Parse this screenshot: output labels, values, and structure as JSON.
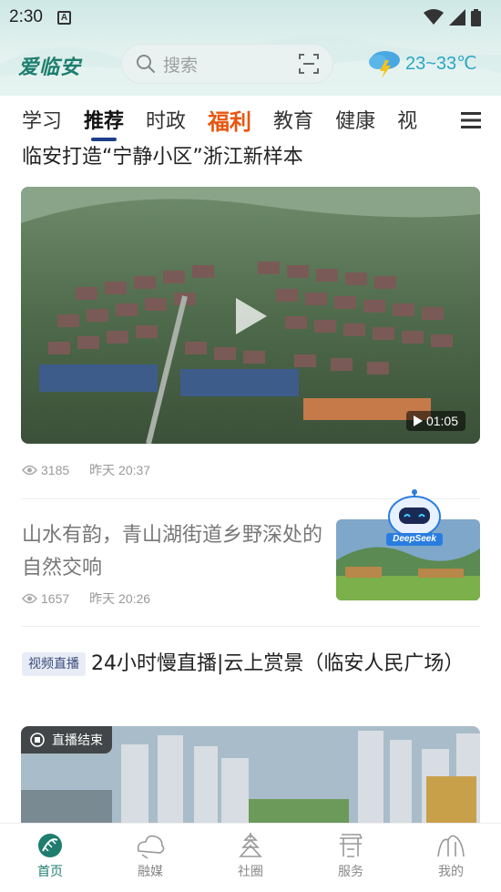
{
  "status_bar": {
    "time": "2:30",
    "notification_letter": "A"
  },
  "header": {
    "logo_text": "爱临安",
    "search_placeholder": "搜索",
    "weather_temp": "23~33℃"
  },
  "tabs": [
    {
      "label": "学习"
    },
    {
      "label": "推荐"
    },
    {
      "label": "时政"
    },
    {
      "label": "福利"
    },
    {
      "label": "教育"
    },
    {
      "label": "健康"
    },
    {
      "label": "视"
    }
  ],
  "feed": {
    "article1": {
      "title": "临安打造“宁静小区”浙江新样本",
      "duration": "01:05",
      "views": "3185",
      "time": "昨天 20:37"
    },
    "article2": {
      "title": "山水有韵，青山湖街道乡野深处的自然交响",
      "views": "1657",
      "time": "昨天 20:26",
      "thumb_badge": "DeepSeek"
    },
    "article3": {
      "tag": "视频直播",
      "title": "24小时慢直播|云上赏景（临安人民广场）",
      "live_status": "直播结束"
    }
  },
  "bottom_nav": [
    {
      "label": "首页"
    },
    {
      "label": "融媒"
    },
    {
      "label": "社圈"
    },
    {
      "label": "服务"
    },
    {
      "label": "我的"
    }
  ],
  "colors": {
    "accent": "#1e7d6e",
    "tab_indicator": "#1d3e8a",
    "promo": "#e8560e",
    "weather": "#2aa6c6"
  }
}
